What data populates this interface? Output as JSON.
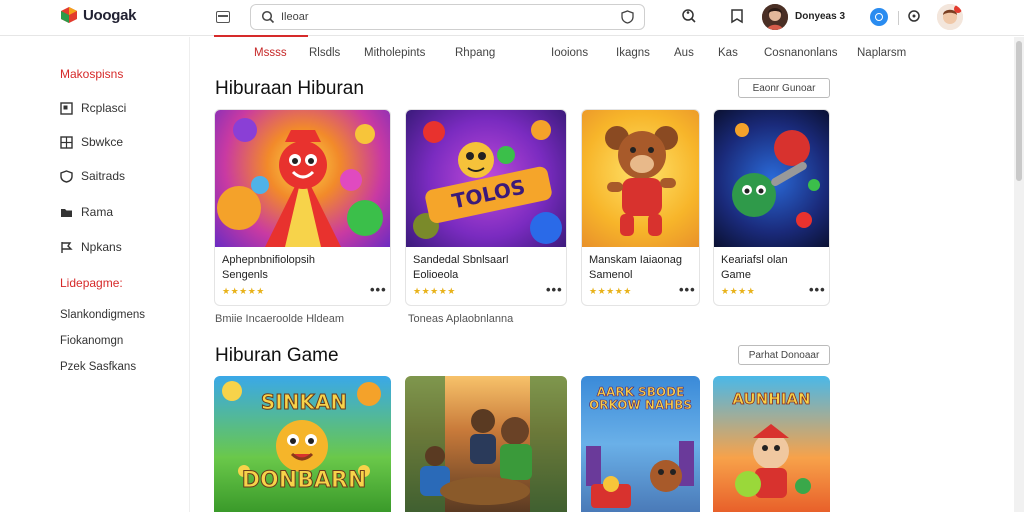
{
  "header": {
    "logo_text": "Uoogak",
    "search_value": "Ileoar",
    "user_name": "Donyeas 3"
  },
  "sidebar": {
    "heading_1": "Makospisns",
    "items": [
      {
        "label": "Rcplasci",
        "icon": "image-icon"
      },
      {
        "label": "Sbwkce",
        "icon": "grid-icon"
      },
      {
        "label": "Saitrads",
        "icon": "shield-icon"
      },
      {
        "label": "Rama",
        "icon": "folder-icon"
      },
      {
        "label": "Npkans",
        "icon": "flag-icon"
      }
    ],
    "heading_2": "Lidepagme:",
    "links": [
      "Slankondigmens",
      "Fiokanomgn",
      "Pzek Sasfkans"
    ]
  },
  "tabs": [
    "Mssss",
    "Rlsdls",
    "Mitholepints",
    "Rhpang",
    "Iooions",
    "Ikagns",
    "Aus",
    "Kas",
    "Cosnanonlans",
    "Naplarsm"
  ],
  "section1": {
    "title": "Hiburaan Hiburan",
    "button": "Eaonr Gunoar",
    "cards": [
      {
        "title_line1": "Aphepnbnifiolopsih",
        "title_line2": "Sengenls",
        "rating": "★★★★★"
      },
      {
        "title_line1": "Sandedal Sbnlsaarl",
        "title_line2": "Eolioeola",
        "rating": "★★★★★"
      },
      {
        "title_line1": "Manskam Iaiaonag",
        "title_line2": "Samenol",
        "rating": "★★★★★"
      },
      {
        "title_line1": "Keariafsl olan",
        "title_line2": "Game",
        "rating": "★★★★"
      }
    ],
    "thumb_texts": [
      "",
      "TOLOS",
      "",
      ""
    ],
    "captions": [
      "Bmiie Incaeroolde Hldeam",
      "Toneas Aplaobnlanna"
    ]
  },
  "section2": {
    "title": "Hiburan Game",
    "button": "Parhat Donoaar",
    "thumb_texts": [
      "SINKAN",
      "",
      "AARK SBODE ORKOW NAHBS",
      "AUNHIAN"
    ],
    "thumb_texts_bottom": [
      "DONBARN",
      "",
      "",
      ""
    ]
  },
  "colors": {
    "accent": "#d62a2a",
    "star": "#e8b21a",
    "blue": "#2a8cf0"
  },
  "icons": {
    "more": "•••"
  }
}
